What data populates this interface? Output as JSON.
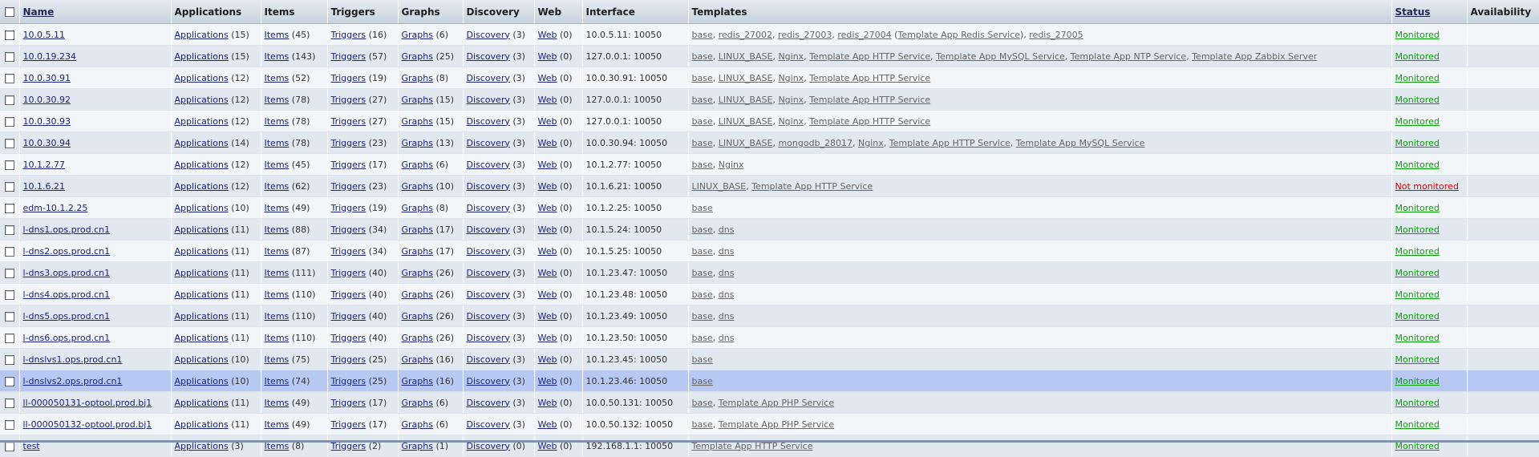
{
  "header": {
    "name": "Name",
    "applications": "Applications",
    "items": "Items",
    "triggers": "Triggers",
    "graphs": "Graphs",
    "discovery": "Discovery",
    "web": "Web",
    "interface": "Interface",
    "templates": "Templates",
    "status": "Status",
    "availability": "Availability"
  },
  "link_labels": {
    "applications": "Applications",
    "items": "Items",
    "triggers": "Triggers",
    "graphs": "Graphs",
    "discovery": "Discovery",
    "web": "Web"
  },
  "colors": {
    "monitored": "#08a008",
    "not_monitored": "#d60000",
    "highlight": "#b7c9f3"
  },
  "rows": [
    {
      "name": "10.0.5.11",
      "apps": "(15)",
      "items": "(45)",
      "triggers": "(16)",
      "graphs": "(6)",
      "discovery": "(3)",
      "web": "(0)",
      "interface": "10.0.5.11: 10050",
      "templates": [
        {
          "t": "base"
        },
        {
          "t": "redis_27002"
        },
        {
          "t": "redis_27003"
        },
        {
          "t": "redis_27004",
          "sub": "Template App Redis Service"
        },
        {
          "t": "redis_27005"
        }
      ],
      "status": "Monitored",
      "monitored": true
    },
    {
      "name": "10.0.19.234",
      "apps": "(15)",
      "items": "(143)",
      "triggers": "(57)",
      "graphs": "(25)",
      "discovery": "(3)",
      "web": "(0)",
      "interface": "127.0.0.1: 10050",
      "templates": [
        {
          "t": "base"
        },
        {
          "t": "LINUX_BASE"
        },
        {
          "t": "Nginx"
        },
        {
          "t": "Template App HTTP Service"
        },
        {
          "t": "Template App MySQL Service"
        },
        {
          "t": "Template App NTP Service"
        },
        {
          "t": "Template App Zabbix Server"
        }
      ],
      "status": "Monitored",
      "monitored": true
    },
    {
      "name": "10.0.30.91",
      "apps": "(12)",
      "items": "(52)",
      "triggers": "(19)",
      "graphs": "(8)",
      "discovery": "(3)",
      "web": "(0)",
      "interface": "10.0.30.91: 10050",
      "templates": [
        {
          "t": "base"
        },
        {
          "t": "LINUX_BASE"
        },
        {
          "t": "Nginx"
        },
        {
          "t": "Template App HTTP Service"
        }
      ],
      "status": "Monitored",
      "monitored": true
    },
    {
      "name": "10.0.30.92",
      "apps": "(12)",
      "items": "(78)",
      "triggers": "(27)",
      "graphs": "(15)",
      "discovery": "(3)",
      "web": "(0)",
      "interface": "127.0.0.1: 10050",
      "templates": [
        {
          "t": "base"
        },
        {
          "t": "LINUX_BASE"
        },
        {
          "t": "Nginx"
        },
        {
          "t": "Template App HTTP Service"
        }
      ],
      "status": "Monitored",
      "monitored": true
    },
    {
      "name": "10.0.30.93",
      "apps": "(12)",
      "items": "(78)",
      "triggers": "(27)",
      "graphs": "(15)",
      "discovery": "(3)",
      "web": "(0)",
      "interface": "127.0.0.1: 10050",
      "templates": [
        {
          "t": "base"
        },
        {
          "t": "LINUX_BASE"
        },
        {
          "t": "Nginx"
        },
        {
          "t": "Template App HTTP Service"
        }
      ],
      "status": "Monitored",
      "monitored": true
    },
    {
      "name": "10.0.30.94",
      "apps": "(14)",
      "items": "(78)",
      "triggers": "(23)",
      "graphs": "(13)",
      "discovery": "(3)",
      "web": "(0)",
      "interface": "10.0.30.94: 10050",
      "templates": [
        {
          "t": "base"
        },
        {
          "t": "LINUX_BASE"
        },
        {
          "t": "mongodb_28017"
        },
        {
          "t": "Nginx"
        },
        {
          "t": "Template App HTTP Service"
        },
        {
          "t": "Template App MySQL Service"
        }
      ],
      "status": "Monitored",
      "monitored": true
    },
    {
      "name": "10.1.2.77",
      "apps": "(12)",
      "items": "(45)",
      "triggers": "(17)",
      "graphs": "(6)",
      "discovery": "(3)",
      "web": "(0)",
      "interface": "10.1.2.77: 10050",
      "templates": [
        {
          "t": "base"
        },
        {
          "t": "Nginx"
        }
      ],
      "status": "Monitored",
      "monitored": true
    },
    {
      "name": "10.1.6.21",
      "apps": "(12)",
      "items": "(62)",
      "triggers": "(23)",
      "graphs": "(10)",
      "discovery": "(3)",
      "web": "(0)",
      "interface": "10.1.6.21: 10050",
      "templates": [
        {
          "t": "LINUX_BASE"
        },
        {
          "t": "Template App HTTP Service"
        }
      ],
      "status": "Not monitored",
      "monitored": false
    },
    {
      "name": "edm-10.1.2.25",
      "apps": "(10)",
      "items": "(49)",
      "triggers": "(19)",
      "graphs": "(8)",
      "discovery": "(3)",
      "web": "(0)",
      "interface": "10.1.2.25: 10050",
      "templates": [
        {
          "t": "base"
        }
      ],
      "status": "Monitored",
      "monitored": true
    },
    {
      "name": "l-dns1.ops.prod.cn1",
      "apps": "(11)",
      "items": "(88)",
      "triggers": "(34)",
      "graphs": "(17)",
      "discovery": "(3)",
      "web": "(0)",
      "interface": "10.1.5.24: 10050",
      "templates": [
        {
          "t": "base"
        },
        {
          "t": "dns"
        }
      ],
      "status": "Monitored",
      "monitored": true
    },
    {
      "name": "l-dns2.ops.prod.cn1",
      "apps": "(11)",
      "items": "(87)",
      "triggers": "(34)",
      "graphs": "(17)",
      "discovery": "(3)",
      "web": "(0)",
      "interface": "10.1.5.25: 10050",
      "templates": [
        {
          "t": "base"
        },
        {
          "t": "dns"
        }
      ],
      "status": "Monitored",
      "monitored": true
    },
    {
      "name": "l-dns3.ops.prod.cn1",
      "apps": "(11)",
      "items": "(111)",
      "triggers": "(40)",
      "graphs": "(26)",
      "discovery": "(3)",
      "web": "(0)",
      "interface": "10.1.23.47: 10050",
      "templates": [
        {
          "t": "base"
        },
        {
          "t": "dns"
        }
      ],
      "status": "Monitored",
      "monitored": true
    },
    {
      "name": "l-dns4.ops.prod.cn1",
      "apps": "(11)",
      "items": "(110)",
      "triggers": "(40)",
      "graphs": "(26)",
      "discovery": "(3)",
      "web": "(0)",
      "interface": "10.1.23.48: 10050",
      "templates": [
        {
          "t": "base"
        },
        {
          "t": "dns"
        }
      ],
      "status": "Monitored",
      "monitored": true
    },
    {
      "name": "l-dns5.ops.prod.cn1",
      "apps": "(11)",
      "items": "(110)",
      "triggers": "(40)",
      "graphs": "(26)",
      "discovery": "(3)",
      "web": "(0)",
      "interface": "10.1.23.49: 10050",
      "templates": [
        {
          "t": "base"
        },
        {
          "t": "dns"
        }
      ],
      "status": "Monitored",
      "monitored": true
    },
    {
      "name": "l-dns6.ops.prod.cn1",
      "apps": "(11)",
      "items": "(110)",
      "triggers": "(40)",
      "graphs": "(26)",
      "discovery": "(3)",
      "web": "(0)",
      "interface": "10.1.23.50: 10050",
      "templates": [
        {
          "t": "base"
        },
        {
          "t": "dns"
        }
      ],
      "status": "Monitored",
      "monitored": true
    },
    {
      "name": "l-dnslvs1.ops.prod.cn1",
      "apps": "(10)",
      "items": "(75)",
      "triggers": "(25)",
      "graphs": "(16)",
      "discovery": "(3)",
      "web": "(0)",
      "interface": "10.1.23.45: 10050",
      "templates": [
        {
          "t": "base"
        }
      ],
      "status": "Monitored",
      "monitored": true
    },
    {
      "name": "l-dnslvs2.ops.prod.cn1",
      "apps": "(10)",
      "items": "(74)",
      "triggers": "(25)",
      "graphs": "(16)",
      "discovery": "(3)",
      "web": "(0)",
      "interface": "10.1.23.46: 10050",
      "templates": [
        {
          "t": "base"
        }
      ],
      "status": "Monitored",
      "monitored": true,
      "highlight": true
    },
    {
      "name": "ll-000050131-optool.prod.bj1",
      "apps": "(11)",
      "items": "(49)",
      "triggers": "(17)",
      "graphs": "(6)",
      "discovery": "(3)",
      "web": "(0)",
      "interface": "10.0.50.131: 10050",
      "templates": [
        {
          "t": "base"
        },
        {
          "t": "Template App PHP Service"
        }
      ],
      "status": "Monitored",
      "monitored": true
    },
    {
      "name": "ll-000050132-optool.prod.bj1",
      "apps": "(11)",
      "items": "(49)",
      "triggers": "(17)",
      "graphs": "(6)",
      "discovery": "(3)",
      "web": "(0)",
      "interface": "10.0.50.132: 10050",
      "templates": [
        {
          "t": "base"
        },
        {
          "t": "Template App PHP Service"
        }
      ],
      "status": "Monitored",
      "monitored": true
    },
    {
      "name": "test",
      "apps": "(3)",
      "items": "(8)",
      "triggers": "(2)",
      "graphs": "(1)",
      "discovery": "(0)",
      "web": "(0)",
      "interface": "192.168.1.1: 10050",
      "templates": [
        {
          "t": "Template App HTTP Service"
        }
      ],
      "status": "Monitored",
      "monitored": true
    }
  ]
}
